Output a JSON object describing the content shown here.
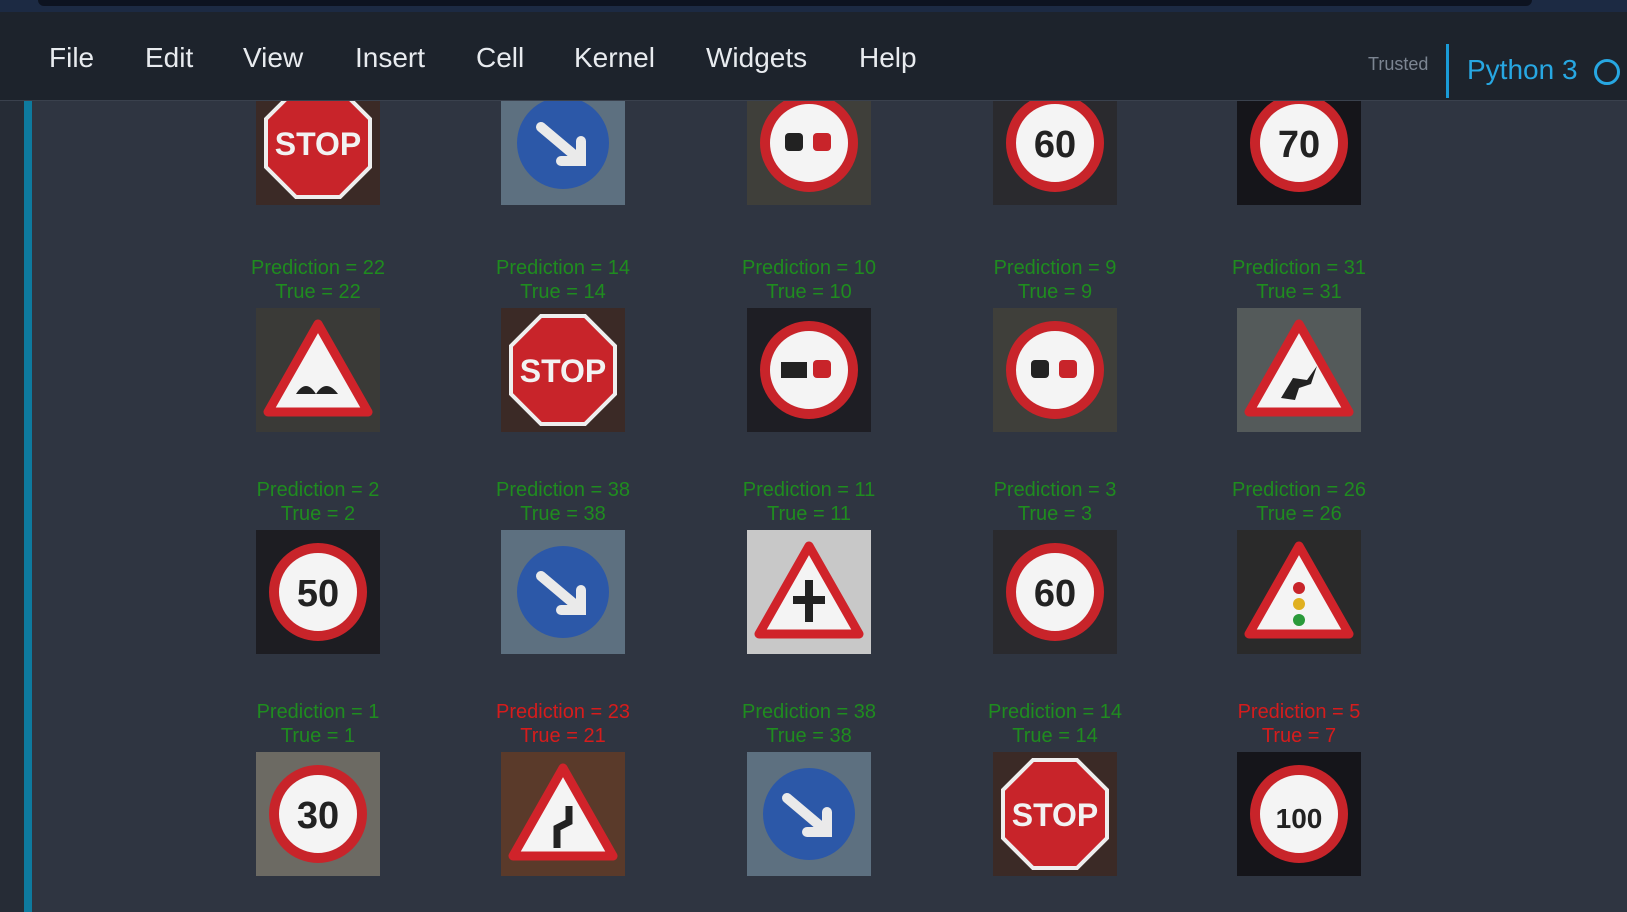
{
  "menubar": {
    "items": [
      "File",
      "Edit",
      "View",
      "Insert",
      "Cell",
      "Kernel",
      "Widgets",
      "Help"
    ],
    "trusted_label": "Trusted",
    "kernel_name": "Python 3"
  },
  "output": {
    "top_row_signs": [
      {
        "sign": "stop-sign"
      },
      {
        "sign": "keep-right-sign"
      },
      {
        "sign": "no-passing-sign"
      },
      {
        "sign": "speed-limit-60-sign"
      },
      {
        "sign": "speed-limit-70-sign"
      }
    ],
    "rows": [
      {
        "items": [
          {
            "prediction": "Prediction = 22",
            "true": "True = 22",
            "correct": true,
            "sign": "bumpy-road-sign"
          },
          {
            "prediction": "Prediction = 14",
            "true": "True = 14",
            "correct": true,
            "sign": "stop-sign"
          },
          {
            "prediction": "Prediction = 10",
            "true": "True = 10",
            "correct": true,
            "sign": "no-passing-trucks-sign"
          },
          {
            "prediction": "Prediction = 9",
            "true": "True = 9",
            "correct": true,
            "sign": "no-passing-sign"
          },
          {
            "prediction": "Prediction = 31",
            "true": "True = 31",
            "correct": true,
            "sign": "wild-animals-crossing-sign"
          }
        ]
      },
      {
        "items": [
          {
            "prediction": "Prediction = 2",
            "true": "True = 2",
            "correct": true,
            "sign": "speed-limit-50-sign"
          },
          {
            "prediction": "Prediction = 38",
            "true": "True = 38",
            "correct": true,
            "sign": "keep-right-sign"
          },
          {
            "prediction": "Prediction = 11",
            "true": "True = 11",
            "correct": true,
            "sign": "right-of-way-sign"
          },
          {
            "prediction": "Prediction = 3",
            "true": "True = 3",
            "correct": true,
            "sign": "speed-limit-60-sign"
          },
          {
            "prediction": "Prediction = 26",
            "true": "True = 26",
            "correct": true,
            "sign": "traffic-signals-sign"
          }
        ]
      },
      {
        "items": [
          {
            "prediction": "Prediction = 1",
            "true": "True = 1",
            "correct": true,
            "sign": "speed-limit-30-sign"
          },
          {
            "prediction": "Prediction = 23",
            "true": "True = 21",
            "correct": false,
            "sign": "double-curve-sign"
          },
          {
            "prediction": "Prediction = 38",
            "true": "True = 38",
            "correct": true,
            "sign": "keep-right-sign"
          },
          {
            "prediction": "Prediction = 14",
            "true": "True = 14",
            "correct": true,
            "sign": "stop-sign"
          },
          {
            "prediction": "Prediction = 5",
            "true": "True = 7",
            "correct": false,
            "sign": "speed-limit-100-sign"
          }
        ]
      }
    ]
  },
  "colors": {
    "correct": "#1f8c1f",
    "incorrect": "#d61c1c",
    "kernel_accent": "#27a7e2",
    "cell_indicator": "#0e7a9e"
  }
}
